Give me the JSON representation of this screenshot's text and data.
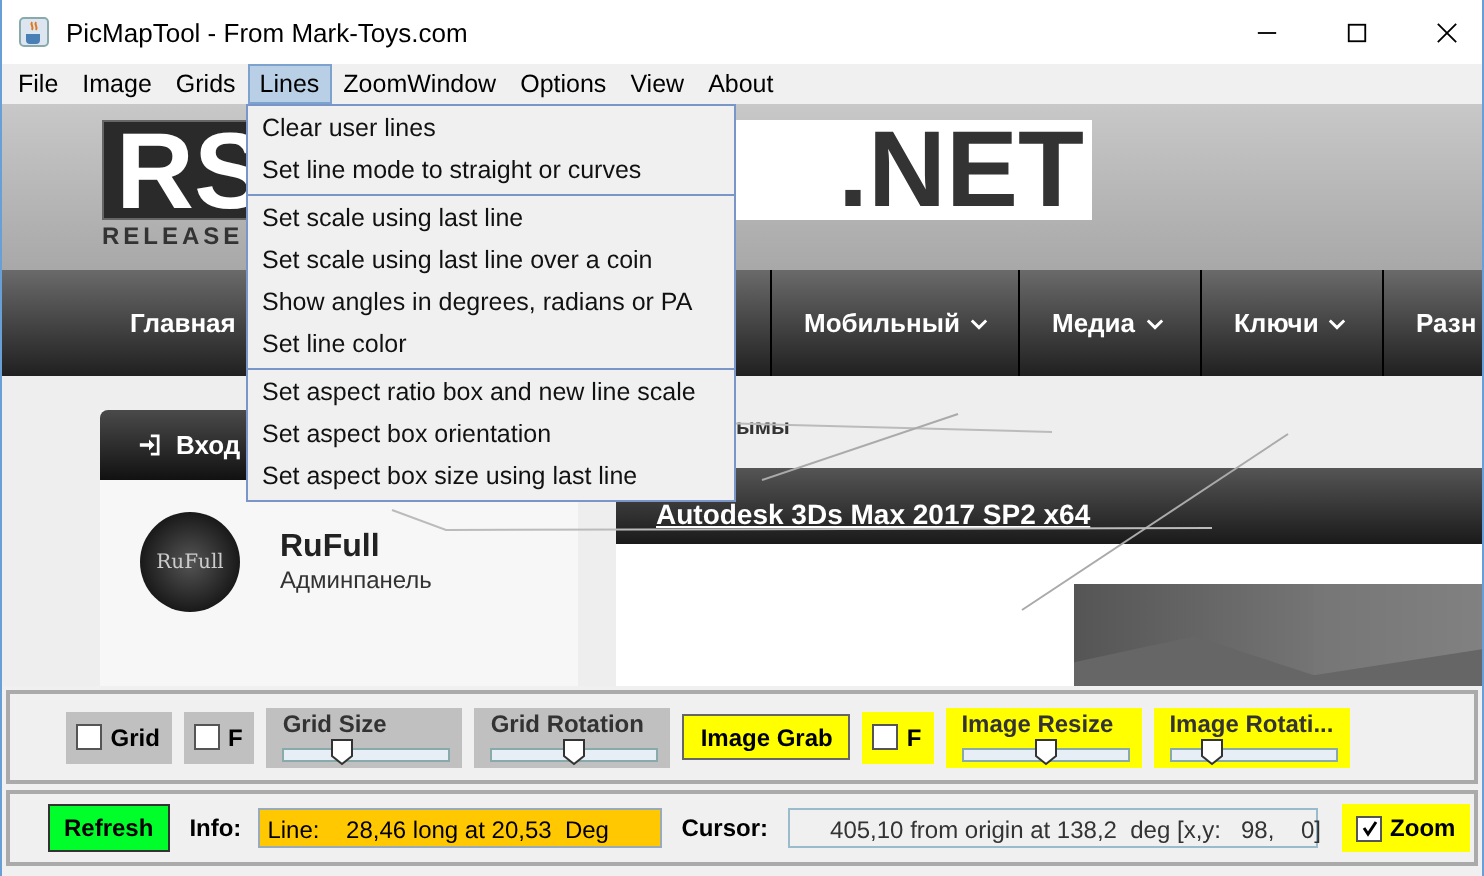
{
  "window": {
    "title": "PicMapTool - From Mark-Toys.com"
  },
  "menu_bar": [
    {
      "label": "File",
      "selected": false
    },
    {
      "label": "Image",
      "selected": false
    },
    {
      "label": "Grids",
      "selected": false
    },
    {
      "label": "Lines",
      "selected": true
    },
    {
      "label": "ZoomWindow",
      "selected": false
    },
    {
      "label": "Options",
      "selected": false
    },
    {
      "label": "View",
      "selected": false
    },
    {
      "label": "About",
      "selected": false
    }
  ],
  "open_menu": {
    "groups": [
      [
        "Clear user lines",
        "Set line mode to straight or curves"
      ],
      [
        "Set scale using last line",
        "Set scale using last line over a coin",
        "Show angles in degrees, radians or PA",
        "Set line color"
      ],
      [
        "Set aspect ratio box and new line scale",
        "Set aspect box orientation",
        "Set aspect box size using last line"
      ]
    ]
  },
  "image": {
    "logo": {
      "left": "RS",
      "right": ".NET",
      "tagline": "RELEASE"
    },
    "nav": [
      {
        "label": "Главная",
        "dropdown": false
      },
      {
        "label": "Мобильный",
        "dropdown": true
      },
      {
        "label": "Медиа",
        "dropdown": true
      },
      {
        "label": "Ключи",
        "dropdown": true
      },
      {
        "label": "Разн",
        "dropdown": false
      }
    ],
    "login_header": "Вход",
    "profile": {
      "avatar_text": "RuFull",
      "name": "RuFull",
      "role": "Админпанель"
    },
    "section_text": "ымы",
    "post_title": "Autodesk 3Ds Max 2017 SP2 x64"
  },
  "toolbar": [
    {
      "kind": "checkbox",
      "label": "Grid",
      "checked": false,
      "highlight": false
    },
    {
      "kind": "checkbox",
      "label": "F",
      "checked": false,
      "highlight": false
    },
    {
      "kind": "slider",
      "label": "Grid Size",
      "level": 0.35,
      "highlight": false
    },
    {
      "kind": "slider",
      "label": "Grid Rotation",
      "level": 0.5,
      "highlight": false
    },
    {
      "kind": "button",
      "label": "Image Grab",
      "highlight": true
    },
    {
      "kind": "checkbox",
      "label": "F",
      "checked": false,
      "highlight": true
    },
    {
      "kind": "slider",
      "label": "Image Resize",
      "level": 0.5,
      "highlight": true
    },
    {
      "kind": "slider",
      "label": "Image Rotati...",
      "level": 0.25,
      "highlight": true
    }
  ],
  "status": {
    "refresh": "Refresh",
    "info_label": "Info:",
    "info": "Line:    28,46 long at 20,53  Deg",
    "cursor_label": "Cursor:",
    "cursor": "405,10 from origin at 138,2  deg [x,y:   98,    0]",
    "zoom": {
      "label": "Zoom",
      "checked": true
    }
  }
}
